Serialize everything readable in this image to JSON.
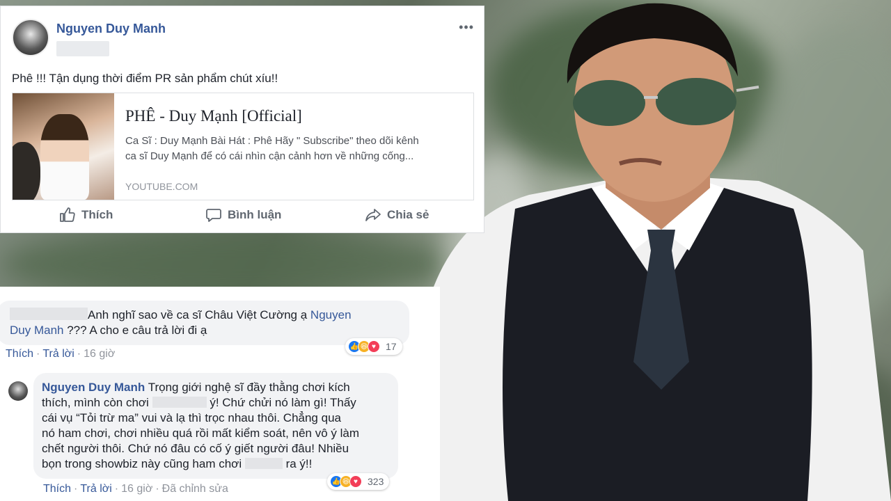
{
  "post": {
    "author": "Nguyen Duy Manh",
    "text": "Phê !!! Tận dụng thời điểm PR sản phẩm chút xíu!!",
    "link": {
      "title": "PHÊ - Duy Mạnh [Official]",
      "desc_line1": "Ca Sĩ : Duy Mạnh Bài Hát : Phê Hãy \" Subscribe\" theo dõi kênh",
      "desc_line2": "ca sĩ Duy Mạnh để có cái nhìn cận cảnh hơn về những cống...",
      "domain": "YOUTUBE.COM"
    },
    "actions": {
      "like": "Thích",
      "comment": "Bình luận",
      "share": "Chia sẻ"
    },
    "more_icon": "ellipsis-icon"
  },
  "comments": [
    {
      "text": "Anh nghĩ sao về ca sĩ Châu Việt Cường ạ",
      "mention_1": "Nguyen",
      "mention_2": "Duy Manh",
      "text_after": "??? A cho e câu trả lời đi ạ",
      "like": "Thích",
      "reply": "Trả lời",
      "time": "16 giờ",
      "reaction_count": "17",
      "reactions": [
        "like",
        "haha",
        "love"
      ]
    },
    {
      "author": "Nguyen Duy Manh",
      "line1": "Trọng giới nghệ sĩ đầy thằng chơi kích",
      "line2a": "thích, mình còn chơi",
      "line2b": "ý! Chứ chửi nó làm gì! Thấy",
      "line3": "cái vụ “Tỏi trừ ma” vui và lạ thì trọc nhau thôi. Chẳng qua",
      "line4": "nó ham chơi, chơi nhiều quá rồi mất kiểm soát, nên vô ý làm",
      "line5": "chết người thôi. Chứ nó đâu có cố ý giết người đâu! Nhiều",
      "line6a": "bọn trong showbiz này cũng ham chơi",
      "line6b": "ra ý!!",
      "like": "Thích",
      "reply": "Trả lời",
      "time": "16 giờ",
      "edited": "Đã chỉnh sửa",
      "reaction_count": "323",
      "reactions": [
        "like",
        "haha",
        "love"
      ]
    }
  ]
}
